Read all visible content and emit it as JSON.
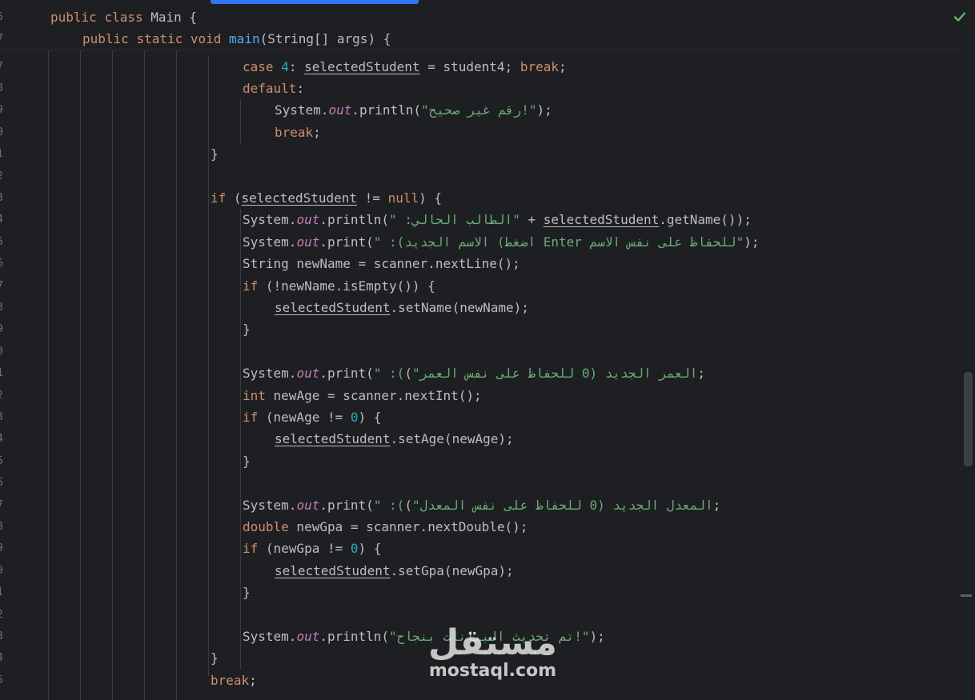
{
  "editor": {
    "sticky_header": [
      {
        "number": "6",
        "indent": 1,
        "tokens": [
          {
            "t": "public",
            "c": "kw"
          },
          {
            "t": " ",
            "c": "id"
          },
          {
            "t": "class",
            "c": "kw"
          },
          {
            "t": " Main {",
            "c": "id"
          }
        ]
      },
      {
        "number": "7",
        "indent": 2,
        "tokens": [
          {
            "t": "public",
            "c": "kw"
          },
          {
            "t": " ",
            "c": "id"
          },
          {
            "t": "static",
            "c": "kw"
          },
          {
            "t": " ",
            "c": "id"
          },
          {
            "t": "void",
            "c": "kw"
          },
          {
            "t": " ",
            "c": "id"
          },
          {
            "t": "main",
            "c": "mth"
          },
          {
            "t": "(String[] args) {",
            "c": "id"
          }
        ]
      }
    ],
    "lines": [
      {
        "number": "7",
        "indent": 7,
        "tokens": [
          {
            "t": "case",
            "c": "kw"
          },
          {
            "t": " ",
            "c": "id"
          },
          {
            "t": "4",
            "c": "num"
          },
          {
            "t": ": ",
            "c": "id"
          },
          {
            "t": "selectedStudent",
            "c": "id u"
          },
          {
            "t": " = student4; ",
            "c": "id"
          },
          {
            "t": "break",
            "c": "kw"
          },
          {
            "t": ";",
            "c": "id"
          }
        ]
      },
      {
        "number": "8",
        "indent": 7,
        "tokens": [
          {
            "t": "default",
            "c": "kw"
          },
          {
            "t": ":",
            "c": "id"
          }
        ]
      },
      {
        "number": "9",
        "indent": 8,
        "tokens": [
          {
            "t": "System.",
            "c": "id"
          },
          {
            "t": "out",
            "c": "fld"
          },
          {
            "t": ".println(",
            "c": "id"
          },
          {
            "t": "\"رقم غير صحيح!\"",
            "c": "str"
          },
          {
            "t": ");",
            "c": "id"
          }
        ]
      },
      {
        "number": "0",
        "indent": 8,
        "tokens": [
          {
            "t": "break",
            "c": "kw"
          },
          {
            "t": ";",
            "c": "id"
          }
        ]
      },
      {
        "number": "1",
        "indent": 6,
        "tokens": [
          {
            "t": "}",
            "c": "id"
          }
        ]
      },
      {
        "number": "2",
        "indent": 0,
        "tokens": []
      },
      {
        "number": "3",
        "indent": 6,
        "tokens": [
          {
            "t": "if",
            "c": "kw"
          },
          {
            "t": " (",
            "c": "id"
          },
          {
            "t": "selectedStudent",
            "c": "id u"
          },
          {
            "t": " != ",
            "c": "id"
          },
          {
            "t": "null",
            "c": "kw"
          },
          {
            "t": ") {",
            "c": "id"
          }
        ]
      },
      {
        "number": "4",
        "indent": 7,
        "tokens": [
          {
            "t": "System.",
            "c": "id"
          },
          {
            "t": "out",
            "c": "fld"
          },
          {
            "t": ".println(",
            "c": "id"
          },
          {
            "t": "\" :الطالب الحالي\"",
            "c": "str"
          },
          {
            "t": " + ",
            "c": "id"
          },
          {
            "t": "selectedStudent",
            "c": "id u"
          },
          {
            "t": ".getName());",
            "c": "id"
          }
        ]
      },
      {
        "number": "5",
        "indent": 7,
        "tokens": [
          {
            "t": "System.",
            "c": "id"
          },
          {
            "t": "out",
            "c": "fld"
          },
          {
            "t": ".print(",
            "c": "id"
          },
          {
            "t": "\" :(الاسم الجديد (اضغط Enter للحفاظ على نفس الاسم\"",
            "c": "str"
          },
          {
            "t": ");",
            "c": "id"
          }
        ]
      },
      {
        "number": "6",
        "indent": 7,
        "tokens": [
          {
            "t": "String newName = scanner.nextLine();",
            "c": "id"
          }
        ]
      },
      {
        "number": "7",
        "indent": 7,
        "tokens": [
          {
            "t": "if",
            "c": "kw"
          },
          {
            "t": " (!newName.isEmpty()) {",
            "c": "id"
          }
        ]
      },
      {
        "number": "8",
        "indent": 8,
        "tokens": [
          {
            "t": "selectedStudent",
            "c": "id u"
          },
          {
            "t": ".setName(newName);",
            "c": "id"
          }
        ]
      },
      {
        "number": "9",
        "indent": 7,
        "tokens": [
          {
            "t": "}",
            "c": "id"
          }
        ]
      },
      {
        "number": "0",
        "indent": 0,
        "tokens": []
      },
      {
        "number": "1",
        "indent": 7,
        "tokens": [
          {
            "t": "System.",
            "c": "id"
          },
          {
            "t": "out",
            "c": "fld"
          },
          {
            "t": ".print(",
            "c": "id"
          },
          {
            "t": "\" :(العمر الجديد (0 للحفاظ على نفس العمر\"",
            "c": "str"
          },
          {
            "t": ");",
            "c": "id"
          }
        ]
      },
      {
        "number": "2",
        "indent": 7,
        "tokens": [
          {
            "t": "int",
            "c": "kw"
          },
          {
            "t": " newAge = scanner.nextInt();",
            "c": "id"
          }
        ]
      },
      {
        "number": "3",
        "indent": 7,
        "tokens": [
          {
            "t": "if",
            "c": "kw"
          },
          {
            "t": " (newAge != ",
            "c": "id"
          },
          {
            "t": "0",
            "c": "num"
          },
          {
            "t": ") {",
            "c": "id"
          }
        ]
      },
      {
        "number": "4",
        "indent": 8,
        "tokens": [
          {
            "t": "selectedStudent",
            "c": "id u"
          },
          {
            "t": ".setAge(newAge);",
            "c": "id"
          }
        ]
      },
      {
        "number": "5",
        "indent": 7,
        "tokens": [
          {
            "t": "}",
            "c": "id"
          }
        ]
      },
      {
        "number": "6",
        "indent": 0,
        "tokens": []
      },
      {
        "number": "7",
        "indent": 7,
        "tokens": [
          {
            "t": "System.",
            "c": "id"
          },
          {
            "t": "out",
            "c": "fld"
          },
          {
            "t": ".print(",
            "c": "id"
          },
          {
            "t": "\" :(المعدل الجديد (0 للحفاظ على نفس المعدل\"",
            "c": "str"
          },
          {
            "t": ");",
            "c": "id"
          }
        ]
      },
      {
        "number": "8",
        "indent": 7,
        "tokens": [
          {
            "t": "double",
            "c": "kw"
          },
          {
            "t": " newGpa = scanner.nextDouble();",
            "c": "id"
          }
        ]
      },
      {
        "number": "9",
        "indent": 7,
        "tokens": [
          {
            "t": "if",
            "c": "kw"
          },
          {
            "t": " (newGpa != ",
            "c": "id"
          },
          {
            "t": "0",
            "c": "num"
          },
          {
            "t": ") {",
            "c": "id"
          }
        ]
      },
      {
        "number": "0",
        "indent": 8,
        "tokens": [
          {
            "t": "selectedStudent",
            "c": "id u"
          },
          {
            "t": ".setGpa(newGpa);",
            "c": "id"
          }
        ]
      },
      {
        "number": "1",
        "indent": 7,
        "tokens": [
          {
            "t": "}",
            "c": "id"
          }
        ]
      },
      {
        "number": "2",
        "indent": 0,
        "tokens": []
      },
      {
        "number": "3",
        "indent": 7,
        "tokens": [
          {
            "t": "System.",
            "c": "id"
          },
          {
            "t": "out",
            "c": "fld"
          },
          {
            "t": ".println(",
            "c": "id"
          },
          {
            "t": "\"تم تحديث البيانات بنجاح!\"",
            "c": "str"
          },
          {
            "t": ");",
            "c": "id"
          }
        ]
      },
      {
        "number": "4",
        "indent": 6,
        "tokens": [
          {
            "t": "}",
            "c": "id"
          }
        ]
      },
      {
        "number": "5",
        "indent": 6,
        "tokens": [
          {
            "t": "break",
            "c": "kw"
          },
          {
            "t": ";",
            "c": "id"
          }
        ]
      }
    ]
  },
  "status": {
    "inspection_icon": "check-icon",
    "color": "#5fb865"
  },
  "watermark": {
    "logo_text": "مستقل",
    "domain": "mostaql.com"
  },
  "colors": {
    "background": "#1e1f22",
    "keyword": "#cf8e6d",
    "string": "#6aab73",
    "number": "#2aacb8",
    "static_field": "#c77dbb",
    "method_declaration": "#56a8f5",
    "identifier": "#bcbec4",
    "line_number": "#6f737a",
    "accent": "#3574f0"
  }
}
